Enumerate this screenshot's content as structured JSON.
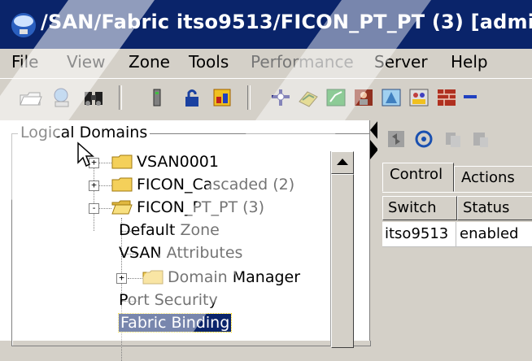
{
  "window": {
    "title": "/SAN/Fabric itso9513/FICON_PT_PT (3) [admi"
  },
  "menu": {
    "items": [
      {
        "label": "File",
        "enabled": true
      },
      {
        "label": "View",
        "enabled": true
      },
      {
        "label": "Zone",
        "enabled": true
      },
      {
        "label": "Tools",
        "enabled": true
      },
      {
        "label": "Performance",
        "enabled": false
      },
      {
        "label": "Server",
        "enabled": true
      },
      {
        "label": "Help",
        "enabled": true
      }
    ]
  },
  "toolbar": {
    "icons": [
      "open-folder-icon",
      "network-icon",
      "binoculars-icon",
      "switch-icon",
      "lock-icon",
      "zone-icon",
      "fabric-icon",
      "module-icon",
      "path-icon",
      "user-icon",
      "device-icon",
      "peer-icon",
      "firewall-icon"
    ]
  },
  "left_pane": {
    "legend": "Logical Domains",
    "tree": [
      {
        "label": "VSAN0001",
        "expander": "+"
      },
      {
        "label": "FICON_Cascaded (2)",
        "expander": "+"
      },
      {
        "label": "FICON_PT_PT (3)",
        "expander": "-"
      },
      {
        "label": "Default Zone"
      },
      {
        "label": "VSAN Attributes"
      },
      {
        "label": "Domain Manager",
        "expander": "+"
      },
      {
        "label": "Port Security"
      },
      {
        "label": "Fabric Binding",
        "selected": true
      }
    ]
  },
  "right_pane": {
    "tabs": [
      "Control",
      "Actions"
    ],
    "table": {
      "headers": [
        "Switch",
        "Status"
      ],
      "rows": [
        [
          "itso9513",
          "enabled"
        ]
      ]
    }
  },
  "colors": {
    "titlebar": "#0a246a",
    "chrome": "#d4d0c8",
    "selection": "#0a246a",
    "folder": "#f4d05a"
  }
}
